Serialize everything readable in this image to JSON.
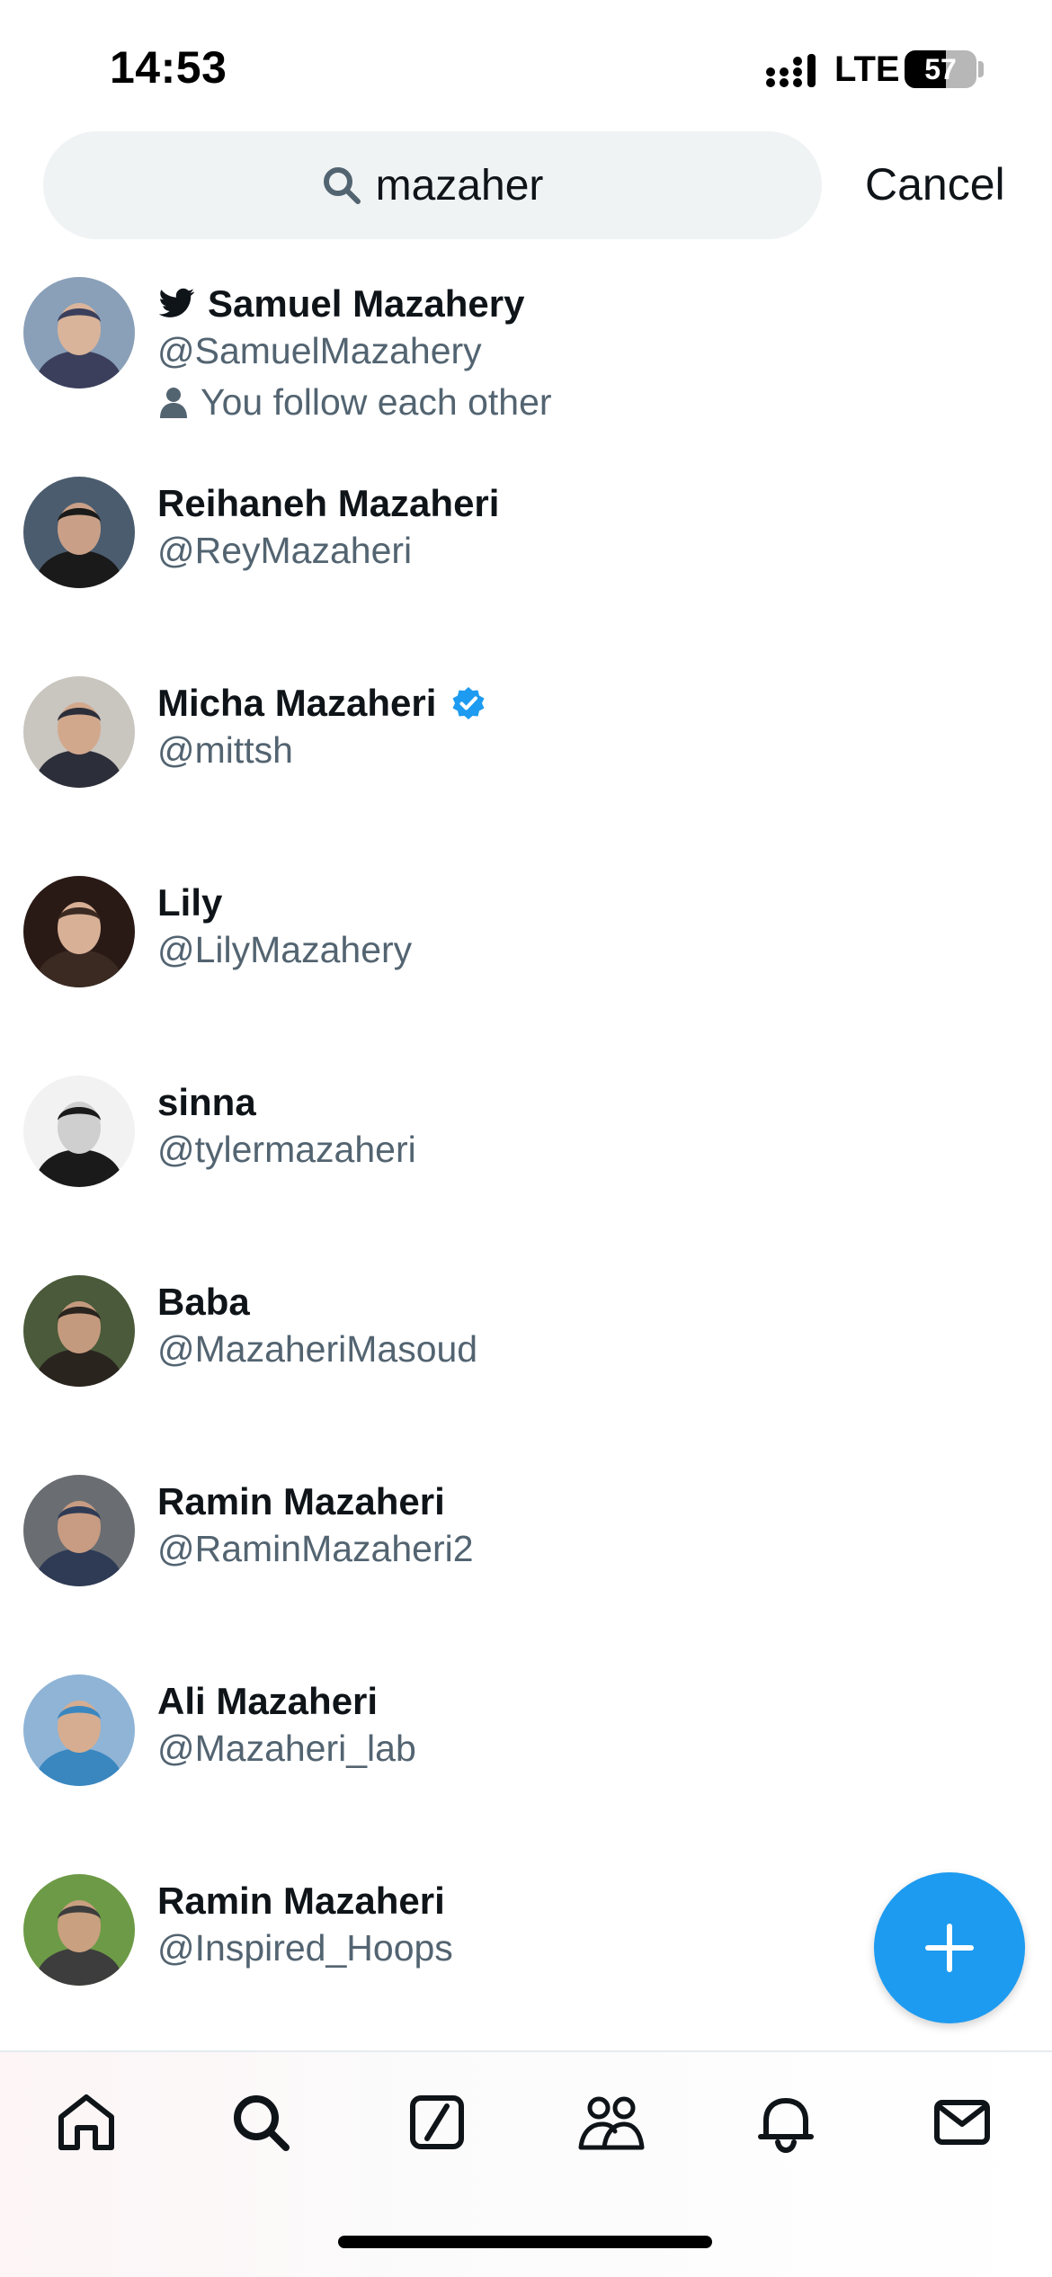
{
  "status_bar": {
    "time": "14:53",
    "network": "LTE",
    "battery_percent": 57,
    "battery_label": "57"
  },
  "search": {
    "query": "mazaher",
    "cancel_label": "Cancel",
    "icon": "search-icon"
  },
  "results": [
    {
      "name": "Samuel Mazahery",
      "handle": "@SamuelMazahery",
      "verified": false,
      "twitter_badge": true,
      "meta": "You follow each other",
      "avatar_colors": [
        "#8aa0b8",
        "#3b3f5c",
        "#d9b49a"
      ]
    },
    {
      "name": "Reihaneh Mazaheri",
      "handle": "@ReyMazaheri",
      "verified": false,
      "twitter_badge": false,
      "meta": "",
      "avatar_colors": [
        "#4b5c6e",
        "#1a1a1a",
        "#c9a087"
      ]
    },
    {
      "name": "Micha Mazaheri",
      "handle": "@mittsh",
      "verified": true,
      "twitter_badge": false,
      "meta": "",
      "avatar_colors": [
        "#c9c5bf",
        "#2c2f3a",
        "#d2a88d"
      ]
    },
    {
      "name": "Lily",
      "handle": "@LilyMazahery",
      "verified": false,
      "twitter_badge": false,
      "meta": "",
      "avatar_colors": [
        "#2a1a16",
        "#3a2a22",
        "#d8b096"
      ]
    },
    {
      "name": "sinna",
      "handle": "@tylermazaheri",
      "verified": false,
      "twitter_badge": false,
      "meta": "",
      "avatar_colors": [
        "#f2f2f2",
        "#1a1a1a",
        "#cfcfcf"
      ]
    },
    {
      "name": "Baba",
      "handle": "@MazaheriMasoud",
      "verified": false,
      "twitter_badge": false,
      "meta": "",
      "avatar_colors": [
        "#4a5a3a",
        "#2a241f",
        "#c49a7e"
      ]
    },
    {
      "name": "Ramin Mazaheri",
      "handle": "@RaminMazaheri2",
      "verified": false,
      "twitter_badge": false,
      "meta": "",
      "avatar_colors": [
        "#6a6e72",
        "#2f3b55",
        "#c79c82"
      ]
    },
    {
      "name": "Ali Mazaheri",
      "handle": "@Mazaheri_lab",
      "verified": false,
      "twitter_badge": false,
      "meta": "",
      "avatar_colors": [
        "#8fb4d6",
        "#3a87c0",
        "#d6ad90"
      ]
    },
    {
      "name": "Ramin Mazaheri",
      "handle": "@Inspired_Hoops",
      "verified": false,
      "twitter_badge": false,
      "meta": "",
      "avatar_colors": [
        "#6d9a46",
        "#3d3d3d",
        "#c9a080"
      ]
    }
  ],
  "fab": {
    "icon": "plus-icon"
  },
  "bottom_nav": [
    {
      "id": "home",
      "icon": "home-icon"
    },
    {
      "id": "search",
      "icon": "search-icon"
    },
    {
      "id": "grok",
      "icon": "grok-icon"
    },
    {
      "id": "communities",
      "icon": "people-icon"
    },
    {
      "id": "notifications",
      "icon": "bell-icon"
    },
    {
      "id": "messages",
      "icon": "mail-icon"
    }
  ],
  "colors": {
    "accent": "#1d9bf0",
    "text_primary": "#0f1419",
    "text_secondary": "#536471",
    "search_bg": "#eff3f4"
  }
}
